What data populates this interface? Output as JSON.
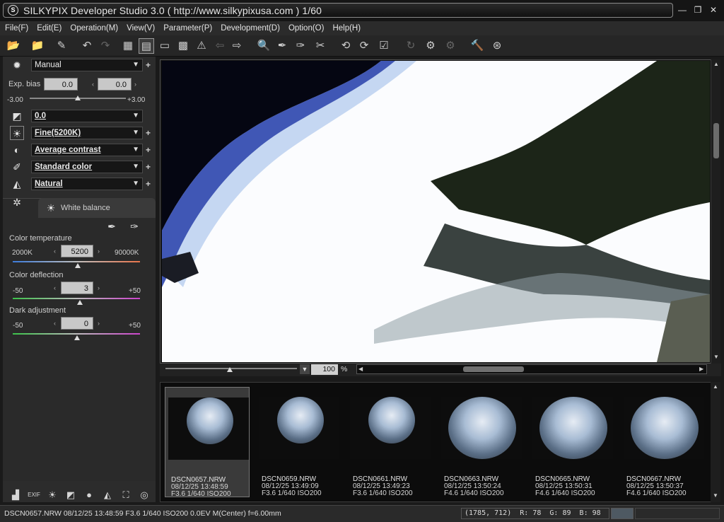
{
  "window": {
    "title": "SILKYPIX Developer Studio 3.0 ( http://www.silkypixusa.com )   1/60",
    "app_icon": "silkypix-logo-icon"
  },
  "menu": [
    "File(F)",
    "Edit(E)",
    "Operation(M)",
    "View(V)",
    "Parameter(P)",
    "Development(D)",
    "Option(O)",
    "Help(H)"
  ],
  "develop": {
    "taste_preset": "Manual",
    "exp_bias_label": "Exp. bias",
    "exp_bias_value": "0.0",
    "exp_bias_value2": "0.0",
    "exp_min": "-3.00",
    "exp_max": "+3.00",
    "tone_preset": "0.0",
    "wb_preset": "Fine(5200K)",
    "contrast_preset": "Average contrast",
    "color_preset": "Standard color",
    "sharpness_preset": "Natural"
  },
  "white_balance": {
    "tab_label": "White balance",
    "color_temp_label": "Color temperature",
    "color_temp_min": "2000K",
    "color_temp_max": "90000K",
    "color_temp_value": "5200",
    "color_deflection_label": "Color deflection",
    "deflection_min": "-50",
    "deflection_max": "+50",
    "deflection_value": "3",
    "dark_label": "Dark adjustment",
    "dark_min": "-50",
    "dark_max": "+50",
    "dark_value": "0"
  },
  "zoom": {
    "value": "100",
    "unit": "%"
  },
  "thumbnails": [
    {
      "name": "DSCN0657.NRW",
      "date": "08/12/25 13:48:59",
      "exposure": "F3.6 1/640 ISO200",
      "selected": true
    },
    {
      "name": "DSCN0659.NRW",
      "date": "08/12/25 13:49:09",
      "exposure": "F3.6 1/640 ISO200",
      "selected": false
    },
    {
      "name": "DSCN0661.NRW",
      "date": "08/12/25 13:49:23",
      "exposure": "F3.6 1/640 ISO200",
      "selected": false
    },
    {
      "name": "DSCN0663.NRW",
      "date": "08/12/25 13:50:24",
      "exposure": "F4.6 1/640 ISO200",
      "selected": false
    },
    {
      "name": "DSCN0665.NRW",
      "date": "08/12/25 13:50:31",
      "exposure": "F4.6 1/640 ISO200",
      "selected": false
    },
    {
      "name": "DSCN0667.NRW",
      "date": "08/12/25 13:50:37",
      "exposure": "F4.6 1/640 ISO200",
      "selected": false
    }
  ],
  "status": {
    "left": "DSCN0657.NRW 08/12/25 13:48:59 F3.6 1/640 ISO200  0.0EV M(Center) f=6.00mm",
    "pixel_info": "(1785, 712)  R: 78  G: 89  B: 98",
    "swatch_color": "#4e5962"
  }
}
